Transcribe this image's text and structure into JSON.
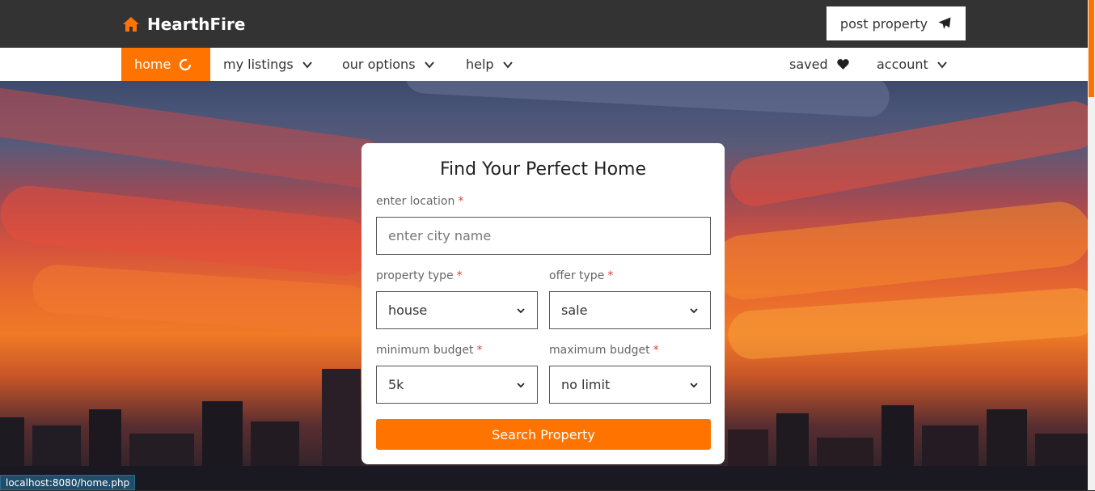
{
  "header": {
    "brand": "HearthFire",
    "brand_icon": "home-icon",
    "post_property_label": "post property",
    "post_property_icon": "paper-plane-icon",
    "accent_color": "#ff7400",
    "bar_color": "#333333"
  },
  "nav": {
    "home": "home",
    "my_listings": "my listings",
    "our_options": "our options",
    "help": "help",
    "saved": "saved",
    "account": "account"
  },
  "search_card": {
    "title": "Find Your Perfect Home",
    "location_label": "enter location",
    "location_placeholder": "enter city name",
    "property_type_label": "property type",
    "property_type_value": "house",
    "offer_type_label": "offer type",
    "offer_type_value": "sale",
    "min_budget_label": "minimum budget",
    "min_budget_value": "5k",
    "max_budget_label": "maximum budget",
    "max_budget_value": "no limit",
    "required_mark": "*",
    "search_button": "Search Property"
  },
  "status_bar": {
    "url": "localhost:8080/home.php"
  }
}
